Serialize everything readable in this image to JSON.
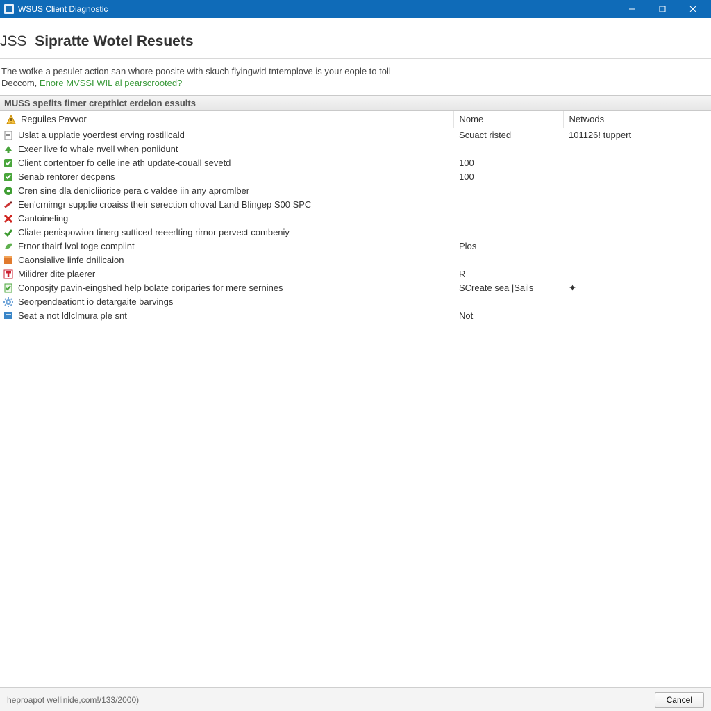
{
  "window": {
    "title": "WSUS Client Diagnostic"
  },
  "page": {
    "title_light": "JSS",
    "title_bold": "Sipratte Wotel Resuets"
  },
  "intro": {
    "line1": "The wofke a pesulet action san whore poosite with skuch flyingwid tntemplove is your eople to toll",
    "line2_prefix": "Deccom, ",
    "line2_green": "Enore MVSSI WIL al pearscrooted?"
  },
  "section": {
    "label": "MUSS spefits fimer crepthict erdeion essults"
  },
  "columns": {
    "desc": "Reguiles Pavvor",
    "name": "Nome",
    "net": "Netwods"
  },
  "rows": [
    {
      "icon": "page",
      "desc": "Uslat a upplatie yoerdest erving rostillcald",
      "name": "Scuact risted",
      "net": "101126! tuppert"
    },
    {
      "icon": "green-up",
      "desc": "Exeer live fo whale nvell when poniidunt",
      "name": "",
      "net": ""
    },
    {
      "icon": "green-box",
      "desc": "Client cortentoer fo celle ine ath update-couall sevetd",
      "name": "100",
      "net": ""
    },
    {
      "icon": "green-box",
      "desc": "Senab rentorer decpens",
      "name": "100",
      "net": ""
    },
    {
      "icon": "green-disc",
      "desc": "Cren sine dla denicliiorice pera c valdee iin any apromlber",
      "name": "",
      "net": ""
    },
    {
      "icon": "red-pencil",
      "desc": "Een'crnimgr supplie croaiss their serection ohoval Land Blingep S00 SPC",
      "name": "",
      "net": ""
    },
    {
      "icon": "red-x",
      "desc": "Cantoineling",
      "name": "",
      "net": ""
    },
    {
      "icon": "green-tick",
      "desc": "Cliate penispowion tinerg sutticed reeerlting rirnor pervect combeniy",
      "name": "",
      "net": ""
    },
    {
      "icon": "green-leaf",
      "desc": "Frnor thairf lvol toge compiint",
      "name": "Plos",
      "net": ""
    },
    {
      "icon": "orange-box",
      "desc": "Caonsialive linfe dnilicaion",
      "name": "",
      "net": ""
    },
    {
      "icon": "red-t",
      "desc": "Milidrer dite plaerer",
      "name": "R",
      "net": ""
    },
    {
      "icon": "green-doc",
      "desc": "Conposjty pavin-eingshed help bolate coriparies for mere sernines",
      "name": "SCreate sea |Sails",
      "net": "✦"
    },
    {
      "icon": "blue-gear",
      "desc": "Seorpendeationt io detargaite barvings",
      "name": "",
      "net": ""
    },
    {
      "icon": "blue-box",
      "desc": "Seat a not ldlclmura ple snt",
      "name": "Not",
      "net": ""
    }
  ],
  "footer": {
    "status": "heproapot wellinide,com!/133/2000)",
    "cancel": "Cancel"
  }
}
